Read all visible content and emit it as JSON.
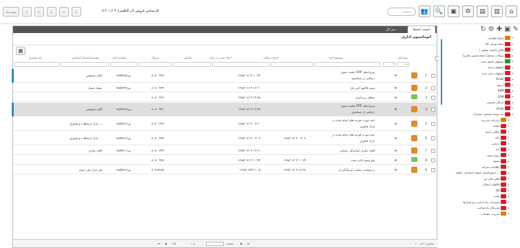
{
  "topbar": {
    "left_buttons": [
      "بوتينة ماه",
      "",
      "",
      "",
      "",
      ""
    ],
    "title": "کارشناس فروش (ل.کاظمی) ۷.۲۰۱.۲.۴",
    "search_placeholder": "جستجو"
  },
  "tabs": [
    "لیست نامه‌ها",
    "میز کار"
  ],
  "window_title": "اتوماسیون اداری",
  "columns": [
    "نوع نامه",
    "موضوع نامه",
    "تاریخ دریافت",
    "ایجاد شده در زمان",
    "هامش",
    "سریال",
    "شماره نامه",
    "موسسه/شرکت/شخص",
    "نام مشتری"
  ],
  "filter_value": "همه",
  "rows": [
    {
      "subject": "جلسه دمون ERP پیرو ایمیل",
      "sub2": "دریافتی از صنایعش",
      "received": "",
      "created": "۱۳۹۸/۰۶/۰۴ ۱۰:۲۴",
      "serial": "۸۰۸۰۰۴۳۳",
      "number": "۹۸/ص/۵۳۹۵",
      "company": "آقای مارهیس",
      "sel": false,
      "tall": true,
      "icon": "person",
      "marked": true
    },
    {
      "subject": "پیش فاکتور آذین پارا",
      "sub2": "",
      "received": "",
      "created": "۱۳۹۸/۰۶/۰۴ ۱۶:۲۰",
      "serial": "۸۰۸۰۰۴۳۴",
      "number": "۹۸/ص/۵۳۹۴",
      "company": "پسپاد بسپار",
      "sel": false,
      "tall": false,
      "icon": "person",
      "marked": false
    },
    {
      "subject": "عطای نرم افزار",
      "sub2": "",
      "received": "",
      "created": "۱۳۹۸/۰۶/۰۴ ۱۴:۳۸",
      "serial": "۸۰۸۰۰۴۳۶",
      "number": "",
      "company": "",
      "sel": false,
      "tall": false,
      "icon": "mail",
      "marked": false
    },
    {
      "subject": "جلسه دمون ERP پیرو ایمیل",
      "sub2": "دریافتی از صنایعش",
      "received": "",
      "created": "۱۳۹۸/۰۶/۰۴ ۱۶:۳۳",
      "serial": "۸۰۸۰۰۴۴۱",
      "number": "۹۸/ص/۵۳۹۳",
      "company": "آقای مارهیس",
      "sel": true,
      "tall": true,
      "icon": "person",
      "marked": true
    },
    {
      "subject": "نامه مودت هزینه های انجام شده در",
      "sub2": "پارک فناوری",
      "received": "",
      "created": "۱۳۹۸/۰۶/۰۴ ۰۹:۲۰",
      "serial": "۸۰۸۰۰۴۴۹",
      "number": "۹۸/ص/۵۳۹۲",
      "company": "پارک ارتباطات و فناوری ...",
      "sel": false,
      "tall": true,
      "icon": "person",
      "marked": false
    },
    {
      "subject": "نامه مودت هزینه های انجام شده در",
      "sub2": "پارک فناوری",
      "received": "۱۳۹۸/۰۶/۰۴ ۰۹:۰۳",
      "created": "۱۳۹۸/۰۶/۰۴ ۰۹:۰۳",
      "serial": "۸۰۸۰۰۴۴۸",
      "number": "۹۸/ص/۵۳۹۱",
      "company": "پارک ارتباطات و فناوری ...",
      "sel": false,
      "tall": true,
      "icon": "person",
      "marked": false
    },
    {
      "subject": "آقای حیاری (نمایندگی حسابی",
      "sub2": "",
      "received": "",
      "created": "۱۳۹۸/۰۶/۰۴ ۱۲:۳۱",
      "serial": "۸۰۸۰۰۴۴۴",
      "number": "۹۸/ص/۵۳۹۰",
      "company": "آقای حیاری",
      "sel": false,
      "tall": false,
      "icon": "person",
      "marked": false
    },
    {
      "subject": "واو وجوه اداره شده",
      "sub2": "",
      "received": "۱۳۹۸/۰۶/۰۴ ۱۰:۳۴",
      "created": "۱۳۹۸/۰۶/۰۴ ۱۰:۳۴",
      "serial": "۸۰۸۰۰۴۵۹",
      "number": "",
      "company": "",
      "sel": false,
      "tall": false,
      "icon": "mail",
      "marked": false
    },
    {
      "subject": "درخواست حمایت ایرینگ‌آی باز",
      "sub2": "",
      "received": "۱۳۹۸/۰۶/۰۴ ۱۶:۲۸",
      "created": "۱۳۹۸/۰۶/۲۳ ۱۰:۵",
      "serial": "۸۰۷۹۷۹۶۵",
      "number": "۹۸/ص/۵۳۸۶",
      "company": "هی بازار ملی ایران",
      "sel": false,
      "tall": false,
      "icon": "person",
      "marked": false
    }
  ],
  "pager": {
    "summary": "نمایش: ۹ از ۱۰۰",
    "page_label": "صفحه",
    "page_of": "از ۱",
    "size": "۲۵"
  },
  "sidebar": [
    {
      "label": "انجام اطلاعات",
      "c": "o"
    },
    {
      "label": "ca:محمد پورکی",
      "c": "r"
    },
    {
      "label": "اقاص (/وحید صفوی )",
      "c": "r"
    },
    {
      "label": "سوالات متداول (محمدحسین باقری)",
      "c": "r"
    },
    {
      "label": "ایمیلهای تکمیل شده",
      "c": "g"
    },
    {
      "label": "ایمیلهای ارشد",
      "c": "r"
    },
    {
      "label": "ایمیلهای حذف شده",
      "c": "r"
    },
    {
      "label": "Email",
      "c": "r"
    },
    {
      "label": "آرشیو",
      "c": "r"
    },
    {
      "label": "BPM",
      "c": "r"
    },
    {
      "label": "CRM",
      "c": "r"
    },
    {
      "label": "بازنگی شخصی",
      "c": "r"
    },
    {
      "label": "email",
      "c": "r"
    },
    {
      "label": "ثبت پوشه شخصی مشترک",
      "c": "r"
    },
    {
      "label": "دبیرخانه مدیریت",
      "c": "o"
    },
    {
      "label": "موقت",
      "c": "r"
    },
    {
      "label": "بایگانی اسناد",
      "c": "r"
    },
    {
      "label": "نامه",
      "c": "r"
    },
    {
      "label": "ارجاعی",
      "c": "r"
    },
    {
      "label": "آدم",
      "c": "r"
    },
    {
      "label": "پروژه تست",
      "c": "r"
    },
    {
      "label": "تستها",
      "c": "r"
    },
    {
      "label": "اطلاعات شرکت",
      "c": "r"
    },
    {
      "label": "دستورالعمل انتشار استاندارد جاهای ...",
      "c": "r"
    },
    {
      "label": "قالبی های من",
      "c": "r"
    },
    {
      "label": "قالبهای ارسالی",
      "c": "r"
    },
    {
      "label": "BS",
      "c": "r"
    },
    {
      "label": "تست",
      "c": "r"
    },
    {
      "label": "مستندات راه اندازی نرم افزارها",
      "c": "r"
    },
    {
      "label": "فرم های پایا ساخت",
      "c": "r"
    },
    {
      "label": "مدیریت جلسات",
      "c": "o"
    }
  ]
}
